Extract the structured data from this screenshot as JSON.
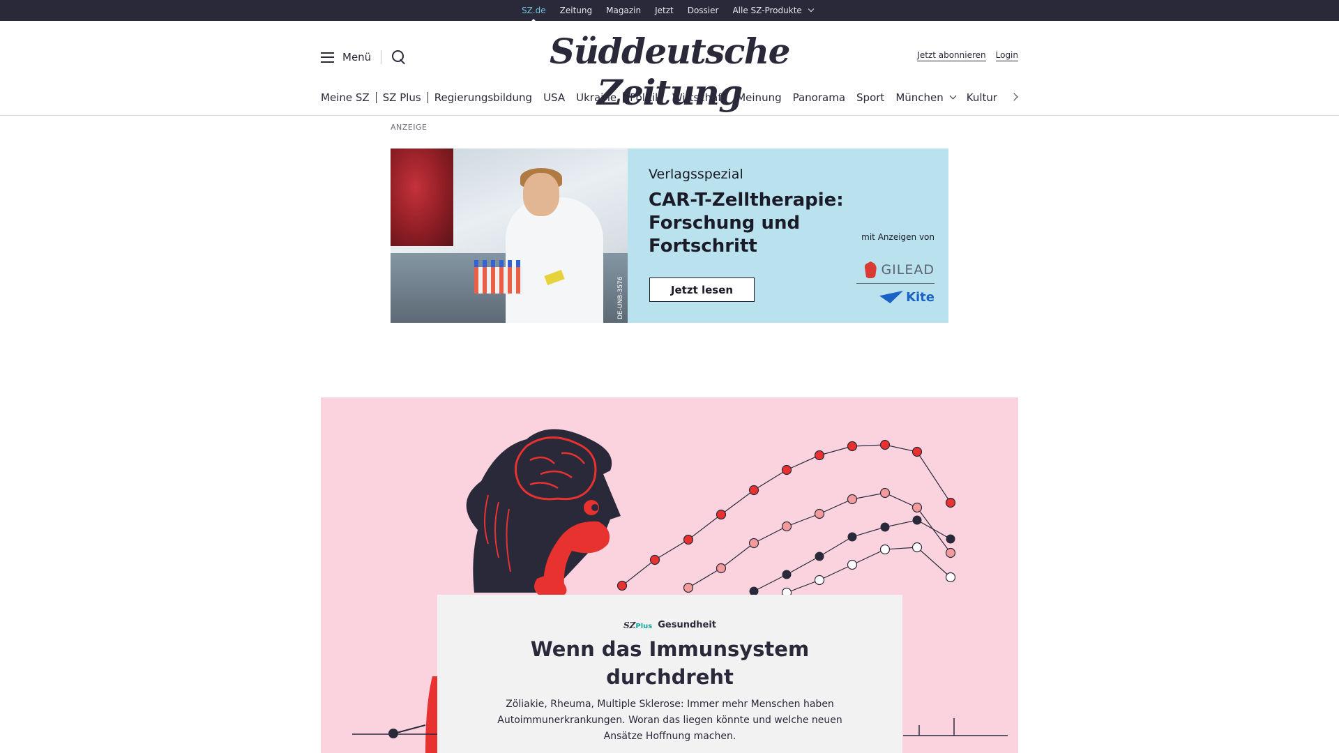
{
  "topbar": {
    "items": [
      "SZ.de",
      "Zeitung",
      "Magazin",
      "Jetzt",
      "Dossier"
    ],
    "products_label": "Alle SZ-Produkte"
  },
  "header": {
    "menu_label": "Menü",
    "logo_text": "Süddeutsche Zeitung",
    "subscribe_label": "Jetzt abonnieren",
    "login_label": "Login"
  },
  "nav": {
    "items": [
      "Meine SZ",
      "SZ Plus",
      "Regierungsbildung",
      "USA",
      "Ukraine",
      "Politik",
      "Wirtschaft",
      "Meinung",
      "Panorama",
      "Sport",
      "München",
      "Kultur"
    ]
  },
  "ad": {
    "label": "ANZEIGE",
    "kicker": "Verlagsspezial",
    "title": "CAR-T-Zelltherapie: Forschung und Fortschritt",
    "button_label": "Jetzt lesen",
    "sponsor_label": "mit Anzeigen von",
    "sponsor_1": "GILEAD",
    "sponsor_2": "Kite",
    "image_code": "DE-UNB-3576"
  },
  "teaser": {
    "brand": "SZ",
    "brand_plus": "Plus",
    "section": "Gesundheit",
    "title": "Wenn das Immunsystem durchdreht",
    "description": "Zöliakie, Rheuma, Multiple Sklerose: Immer mehr Menschen haben Autoimmunerkrankungen. Woran das liegen könnte und welche neuen Ansätze Hoffnung machen."
  },
  "colors": {
    "topbar_bg": "#29293a",
    "active_link": "#71c5d9",
    "ad_bg": "#b9e1ee",
    "teaser_bg": "#fbd3de",
    "illustration_red": "#e8322f",
    "szplus_teal": "#15a59b"
  }
}
